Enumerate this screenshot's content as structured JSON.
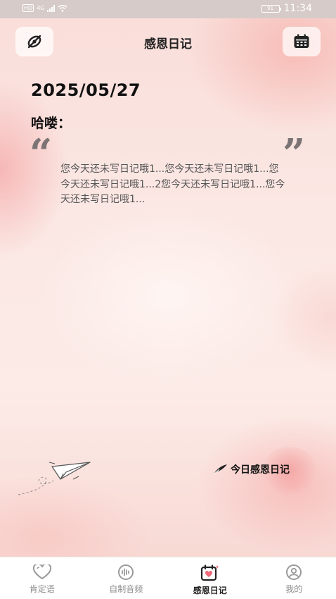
{
  "status_bar": {
    "network_badge": "HD",
    "signal_label": "4G",
    "battery": "91",
    "time": "11:34"
  },
  "header": {
    "title": "感恩日记",
    "left_icon": "eye-off-icon",
    "right_icon": "calendar-icon"
  },
  "diary": {
    "date": "2025/05/27",
    "greeting": "哈喽：",
    "quote_open": "“",
    "quote_close": "”",
    "text": "您今天还未写日记哦1...您今天还未写日记哦1...您今天还未写日记哦1...2您今天还未写日记哦1...您今天还未写日记哦1..."
  },
  "today_entry": {
    "label": "今日感恩日记",
    "icon": "feather-pen-icon"
  },
  "tabs": [
    {
      "label": "肯定语",
      "icon": "heart-icon",
      "active": false
    },
    {
      "label": "自制音频",
      "icon": "audio-wave-icon",
      "active": false
    },
    {
      "label": "感恩日记",
      "icon": "calendar-heart-icon",
      "active": true
    },
    {
      "label": "我的",
      "icon": "user-icon",
      "active": false
    }
  ],
  "colors": {
    "background": "#fbe9e6",
    "accent_pink": "#f08c8c",
    "text_dark": "#111111",
    "text_body": "#555555",
    "tab_inactive": "#8d8d8d"
  }
}
